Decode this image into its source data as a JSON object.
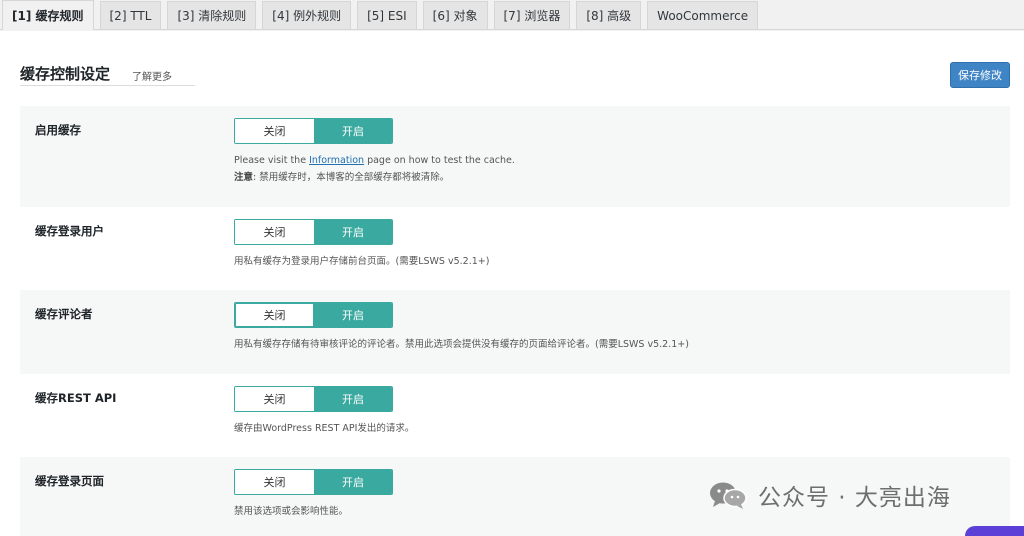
{
  "tabs": [
    {
      "label": "[1] 缓存规则",
      "active": true
    },
    {
      "label": "[2] TTL"
    },
    {
      "label": "[3] 清除规则"
    },
    {
      "label": "[4] 例外规则"
    },
    {
      "label": "[5] ESI"
    },
    {
      "label": "[6] 对象"
    },
    {
      "label": "[7] 浏览器"
    },
    {
      "label": "[8] 高级"
    },
    {
      "label": "WooCommerce"
    }
  ],
  "section": {
    "title": "缓存控制设定",
    "learn_more": "了解更多"
  },
  "save_label": "保存修改",
  "toggle": {
    "off": "关闭",
    "on": "开启"
  },
  "settings": [
    {
      "label": "启用缓存",
      "desc_pre": "Please visit the ",
      "desc_link": "Information",
      "desc_post": " page on how to test the cache.",
      "note_label": "注意",
      "note_text": ": 禁用缓存时，本博客的全部缓存都将被清除。"
    },
    {
      "label": "缓存登录用户",
      "desc": "用私有缓存为登录用户存储前台页面。(需要LSWS v5.2.1+)"
    },
    {
      "label": "缓存评论者",
      "desc": "用私有缓存存储有待审核评论的评论者。禁用此选项会提供没有缓存的页面给评论者。(需要LSWS v5.2.1+)"
    },
    {
      "label": "缓存REST API",
      "desc": "缓存由WordPress REST API发出的请求。"
    },
    {
      "label": "缓存登录页面",
      "desc": "禁用该选项或会影响性能。"
    }
  ],
  "watermark": {
    "text": "公众号 · 大亮出海",
    "icon": "wechat-icon"
  },
  "colors": {
    "accent": "#3aa99f",
    "save_button": "#3f85c6",
    "link": "#2271b1"
  }
}
